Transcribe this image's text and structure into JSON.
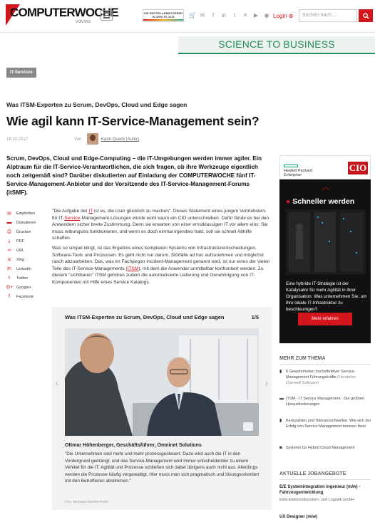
{
  "header": {
    "logo_text": "COMPUTERWOCHE",
    "logo_sub": "VON IDG",
    "award_line1": "DIE BESTEN ARBEITGEBER",
    "award_line2": "IN DER ITK 2018",
    "icons": [
      "cart-icon",
      "mail-icon",
      "facebook-icon",
      "linkedin-icon",
      "twitter-icon",
      "xing-icon",
      "youtube-icon",
      "rss-icon"
    ],
    "login_label": "Login",
    "search_placeholder": "Suchen nach ..."
  },
  "s2b": {
    "label": "SCIENCE TO BUSINESS"
  },
  "article": {
    "tag": "IT-Services",
    "kicker": "Was ITSM-Experten zu Scrum, DevOps, Cloud und Edge sagen",
    "title": "Wie agil kann IT-Service-Management sein?",
    "date": "19.10.2017",
    "von": "Von",
    "author": "Karin Quack (Autor)",
    "intro": "Scrum, DevOps, Cloud und Edge-Computing – die IT-Umgebungen werden immer agiler. Ein Alptraum für die IT-Service-Verantwortlichen, die sich fragen, ob ihre Werkzeuge eigentlich noch zeitgemäß sind? Darüber diskutierten auf Einladung der COMPUTERWOCHE fünf IT-Service-Management-Anbieter und der Vorsitzende des IT-Service-Management-Forums (itSMF).",
    "p1_a": "\"Die Aufgabe der ",
    "p1_it": "IT",
    "p1_b": " ist es, die User glücklich zu machen\". Dieses Statement eines jungen Vertriebslers für IT-",
    "p1_service": "Service",
    "p1_c": "-Management-Lösungen würde wohl kaum ein CIO unterschreiben. Dafür fände es bei den Anwendern sicher breite Zustimmung. Denn sie erwarten von einer ernstklassigen IT vor allem eins: Sie muss reibungslos funktionieren, und wenn es doch einmal irgendwo hakt, soll sie schnell Abhilfe schaffen.",
    "p2_a": "Was so simpel klingt, ist das Ergebnis eines komplexen Systems von Infrastrukturentscheidungen, Software-Tools und Prozessen. Es geht nicht nur darum, Störfälle ad hoc aufzunehmen und möglichst rasch abzuarbeiten. Das, was im Fachjargon Incident-Management genannt wird, ist nur eines der vielen Teile des IT-Service-Managements (",
    "p2_itsm": "ITSM",
    "p2_b": "), mit dem die Anwender unmittelbar konfrontiert werden. Zu diesem \"sichtbaren\" ITSM gehören zudem die automatisierte Lieferung und Genehmigung von IT-Komponenten mit Hilfe eines Service Katalogs."
  },
  "share": [
    {
      "icon": "mail-icon",
      "glyph": "✉",
      "label": "Empfehlen"
    },
    {
      "icon": "comment-icon",
      "glyph": "▬",
      "label": "Diskutieren"
    },
    {
      "icon": "print-icon",
      "glyph": "⎙",
      "label": "Drucken"
    },
    {
      "icon": "pdf-icon",
      "glyph": "⤓",
      "label": "PDF"
    },
    {
      "icon": "link-icon",
      "glyph": "∞",
      "label": "URL"
    },
    {
      "icon": "xing-icon",
      "glyph": "✕",
      "label": "Xing"
    },
    {
      "icon": "linkedin-icon",
      "glyph": "in",
      "label": "LinkedIn"
    },
    {
      "icon": "twitter-icon",
      "glyph": "t",
      "label": "Twitter"
    },
    {
      "icon": "googleplus-icon",
      "glyph": "G+",
      "label": "Google+"
    },
    {
      "icon": "facebook-icon",
      "glyph": "f",
      "label": "Facebook"
    }
  ],
  "gallery": {
    "title": "Was ITSM-Experten zu Scrum, DevOps, Cloud und Edge sagen",
    "count": "1/5",
    "caption_title": "Ottmar Höhenberger, Geschäftsführer, Omninet Solutions",
    "caption": "\"Die Unternehmen sind mehr und mehr prozessgesteuert. Dazu wird auch die IT in den Vordergrund gedrängt, und das Service-Management wird immer entscheidender zu einem Vehikel für die IT. Agilität und Prozesse schließen sich dabei übrigens auch nicht aus. Allerdings werden die Prozesse häufig vergewaltigt. Hier muss man sich pragmatisch und lösungsorientiert mit den Betroffenen abstimmen.\"",
    "credit": "Foto: Michaela Handrek-Rehle"
  },
  "ad": {
    "hpe": "Hewlett Packard\nEnterprise",
    "cio": "CIO",
    "headline": "Schneller werden",
    "text": "Eine hybride IT-Strategie ist der Katalysator für mehr Agilität in ihrer Organisation. Was unternehmen Sie, um ihre lokale IT-Infrastruktur zu beschleunigen?",
    "button": "Mehr erfahren"
  },
  "sidebar": {
    "more_title": "MEHR ZUM THEMA",
    "related": [
      {
        "icon": "document-icon",
        "glyph": "▮",
        "text": "5 Gewohnheiten hocheffektiver Service-Management Führungskräfte",
        "source": "(Hersteller: Cherwell Software)"
      },
      {
        "icon": "article-icon",
        "glyph": "▬",
        "text": "ITSM - IT Service Management - Die größten Herausforderungen",
        "source": ""
      },
      {
        "icon": "document-icon",
        "glyph": "▮",
        "text": "Kennzahlen und Toleranzschwellen: Wie sich der Erfolg von Service Management messen lässt",
        "source": ""
      },
      {
        "icon": "camera-icon",
        "glyph": "◙",
        "text": "Systeme für Hybrid Cloud Management",
        "source": ""
      }
    ],
    "jobs_title": "AKTUELLE JOBANGEBOTE",
    "jobs": [
      {
        "title": "E/E Systemintegration Ingenieur (m/w) - Fahrzeugentwicklung",
        "company": "ESG Elektroniksystem- und Logistik GmbH"
      },
      {
        "title": "UX Designer (m/w)",
        "company": ""
      }
    ]
  },
  "colors": {
    "brand_red": "#d3151c",
    "s2b_green": "#1c8d5c"
  }
}
